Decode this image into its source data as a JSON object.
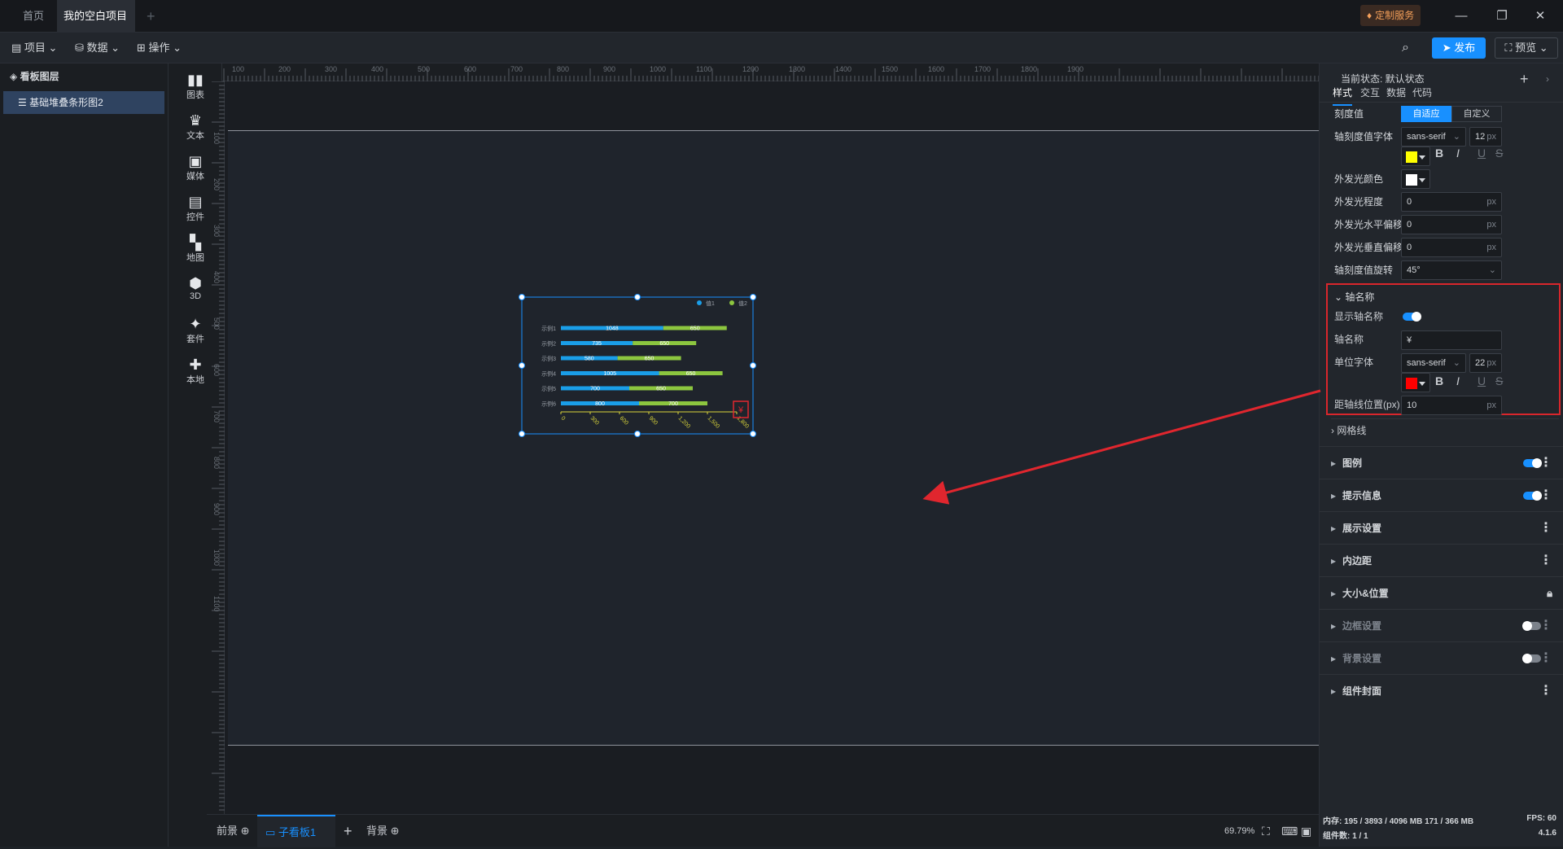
{
  "titlebar": {
    "tabs": [
      {
        "label": "首页"
      },
      {
        "label": "我的空白项目"
      }
    ],
    "custom_service": "定制服务",
    "add_tab": "+"
  },
  "toolbar": {
    "menus": [
      {
        "label": "项目"
      },
      {
        "label": "数据"
      },
      {
        "label": "操作"
      }
    ],
    "publish": "发布",
    "preview": "预览"
  },
  "layers": {
    "title": "看板图层",
    "items": [
      {
        "label": "基础堆叠条形图2"
      }
    ]
  },
  "tools": [
    {
      "label": "图表"
    },
    {
      "label": "文本"
    },
    {
      "label": "媒体"
    },
    {
      "label": "控件"
    },
    {
      "label": "地图"
    },
    {
      "label": "3D"
    },
    {
      "label": "套件"
    },
    {
      "label": "本地"
    }
  ],
  "ruler": {
    "top": [
      "100",
      "200",
      "300",
      "400",
      "500",
      "600",
      "700",
      "800",
      "900",
      "1000",
      "1100",
      "1200",
      "1300",
      "1400",
      "1500",
      "1600",
      "1700",
      "1800",
      "1900"
    ],
    "left": [
      "100",
      "200",
      "300",
      "400",
      "500",
      "600",
      "700",
      "800",
      "900",
      "1000",
      "1100"
    ]
  },
  "chart_data": {
    "type": "bar",
    "orientation": "horizontal",
    "stacked": true,
    "categories": [
      "示例1",
      "示例2",
      "示例3",
      "示例4",
      "示例5",
      "示例6"
    ],
    "series": [
      {
        "name": "值1",
        "values": [
          1048,
          735,
          580,
          1005,
          700,
          800
        ],
        "color": "#1a9ee8"
      },
      {
        "name": "值2",
        "values": [
          650,
          650,
          650,
          650,
          650,
          700
        ],
        "color": "#8cc63f"
      }
    ],
    "x_ticks": [
      "0",
      "300",
      "600",
      "900",
      "1,200",
      "1,500",
      "1,800"
    ],
    "xlim": [
      0,
      1800
    ],
    "x_axis_name": "¥",
    "legend": "top-right",
    "axis_color": "#d8d43a"
  },
  "bottom": {
    "front": "前景",
    "subboard": "子看板1",
    "add": "+",
    "back": "背景",
    "zoom": "69.79%"
  },
  "panel": {
    "state_label": "当前状态: 默认状态",
    "tabs": [
      {
        "label": "样式"
      },
      {
        "label": "交互"
      },
      {
        "label": "数据"
      },
      {
        "label": "代码"
      }
    ],
    "tick_value": {
      "label": "刻度值",
      "opt_auto": "自适应",
      "opt_custom": "自定义"
    },
    "tick_font": {
      "label": "轴刻度值字体",
      "font": "sans-serif",
      "size": "12",
      "unit": "px",
      "color": "#ffff00"
    },
    "glow_color": {
      "label": "外发光颜色",
      "color": "#ffffff"
    },
    "glow_level": {
      "label": "外发光程度",
      "value": "0",
      "unit": "px"
    },
    "glow_h": {
      "label": "外发光水平偏移",
      "value": "0",
      "unit": "px"
    },
    "glow_v": {
      "label": "外发光垂直偏移",
      "value": "0",
      "unit": "px"
    },
    "tick_rotate": {
      "label": "轴刻度值旋转",
      "value": "45°"
    },
    "axis_name_section": {
      "title": "轴名称",
      "show_label": "显示轴名称",
      "name_label": "轴名称",
      "name_value": "¥",
      "unit_font_label": "单位字体",
      "unit_font": "sans-serif",
      "unit_size": "22",
      "unit": "px",
      "unit_color": "#ff0000",
      "distance_label": "距轴线位置(px)",
      "distance_value": "10",
      "distance_unit": "px"
    },
    "grid_section": "网格线",
    "sections": [
      {
        "label": "图例",
        "toggle": true
      },
      {
        "label": "提示信息",
        "toggle": true
      },
      {
        "label": "展示设置"
      },
      {
        "label": "内边距"
      },
      {
        "label": "大小&位置"
      },
      {
        "label": "边框设置",
        "toggle_off": true
      },
      {
        "label": "背景设置",
        "toggle_off": true
      },
      {
        "label": "组件封面"
      }
    ],
    "status": {
      "memory": "内存: 195 / 3893 / 4096 MB  171 / 366 MB",
      "fps": "FPS: 60",
      "components": "组件数: 1 / 1",
      "version": "4.1.6"
    }
  }
}
